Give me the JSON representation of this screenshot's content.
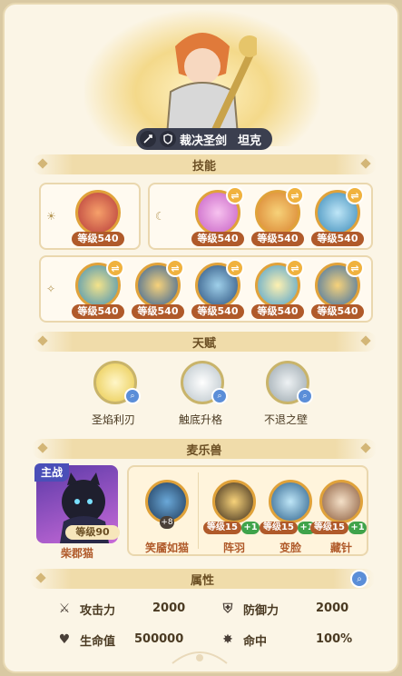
{
  "hero": {
    "class_name": "裁决圣剑",
    "role": "坦克"
  },
  "sections": {
    "skills": "技能",
    "talents": "天赋",
    "pets": "麦乐兽",
    "attributes": "属性"
  },
  "skills": {
    "row1_left": [
      {
        "level": "等级540",
        "color": "#b73b3b"
      }
    ],
    "row1_right": [
      {
        "level": "等级540",
        "color": "#c65fc4"
      },
      {
        "level": "等级540",
        "color": "#d9822f"
      },
      {
        "level": "等级540",
        "color": "#3a8ab8"
      }
    ],
    "row2": [
      {
        "level": "等级540",
        "color": "#3f8fb8"
      },
      {
        "level": "等级540",
        "color": "#2f5f9a"
      },
      {
        "level": "等级540",
        "color": "#2a4f7c"
      },
      {
        "level": "等级540",
        "color": "#4a9fd0"
      },
      {
        "level": "等级540",
        "color": "#3a6fa8"
      }
    ]
  },
  "talents": [
    {
      "name": "圣焰利刃",
      "color": "#e9c94a"
    },
    {
      "name": "触底升格",
      "color": "#b8c3c9"
    },
    {
      "name": "不退之壁",
      "color": "#9aa6ad"
    }
  ],
  "pets": {
    "main_tag": "主战",
    "main_level": "等级90",
    "main_name": "柴郡猫",
    "feature_name": "笑靥如猫",
    "feature_badge": "+8",
    "others": [
      {
        "level": "等级15",
        "plus": "+1",
        "name": "阵羽",
        "color": "#d9822f"
      },
      {
        "level": "等级15",
        "plus": "+1",
        "name": "变脸",
        "color": "#3a8ab8"
      },
      {
        "level": "等级15",
        "plus": "+1",
        "name": "藏针",
        "color": "#c07a4a"
      }
    ]
  },
  "attributes": [
    {
      "label": "攻击力",
      "value": "2000",
      "icon": "crossed-swords-icon"
    },
    {
      "label": "防御力",
      "value": "2000",
      "icon": "shield-icon"
    },
    {
      "label": "生命值",
      "value": "500000",
      "icon": "heart-icon"
    },
    {
      "label": "命中",
      "value": "100%",
      "icon": "target-star-icon"
    }
  ]
}
